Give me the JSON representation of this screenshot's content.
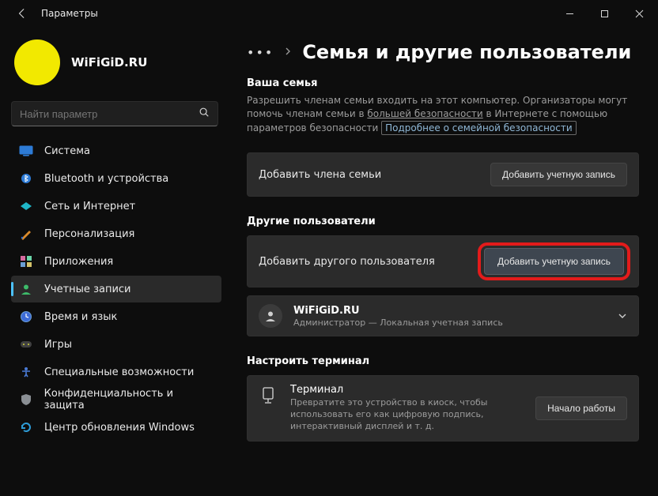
{
  "window": {
    "title": "Параметры"
  },
  "user": {
    "name": "WiFiGiD.RU"
  },
  "search": {
    "placeholder": "Найти параметр"
  },
  "nav": {
    "items": [
      {
        "label": "Система",
        "icon": "system",
        "color": "#2d7bd6"
      },
      {
        "label": "Bluetooth и устройства",
        "icon": "bluetooth",
        "color": "#2d7bd6"
      },
      {
        "label": "Сеть и Интернет",
        "icon": "network",
        "color": "#1fb6c7"
      },
      {
        "label": "Персонализация",
        "icon": "personalize",
        "color": "#d98a2b"
      },
      {
        "label": "Приложения",
        "icon": "apps",
        "color": "#d46a9e"
      },
      {
        "label": "Учетные записи",
        "icon": "accounts",
        "color": "#3dbb6a"
      },
      {
        "label": "Время и язык",
        "icon": "time",
        "color": "#3d6bd6"
      },
      {
        "label": "Игры",
        "icon": "gaming",
        "color": "#cfd23a"
      },
      {
        "label": "Специальные возможности",
        "icon": "accessibility",
        "color": "#4a7bd6"
      },
      {
        "label": "Конфиденциальность и защита",
        "icon": "privacy",
        "color": "#8a8f94"
      },
      {
        "label": "Центр обновления Windows",
        "icon": "update",
        "color": "#2d9bd6"
      }
    ]
  },
  "page": {
    "title": "Семья и другие пользователи"
  },
  "family": {
    "title": "Ваша семья",
    "desc_pre": "Разрешить членам семьи входить на этот компьютер. Организаторы могут помочь членам семьи в ",
    "desc_underlined": "большей безопасности",
    "desc_mid": " в Интернете с помощью параметров безопасности ",
    "link": "Подробнее о семейной безопасности",
    "add_member_label": "Добавить члена семьи",
    "add_button": "Добавить учетную запись"
  },
  "others": {
    "title": "Другие пользователи",
    "add_label": "Добавить другого пользователя",
    "add_button": "Добавить учетную запись",
    "account": {
      "name": "WiFiGiD.RU",
      "sub": "Администратор — Локальная учетная запись"
    }
  },
  "terminal": {
    "title": "Настроить терминал",
    "item_title": "Терминал",
    "item_desc": "Превратите это устройство в киоск, чтобы использовать его как цифровую подпись, интерактивный дисплей и т. д.",
    "button": "Начало работы"
  }
}
